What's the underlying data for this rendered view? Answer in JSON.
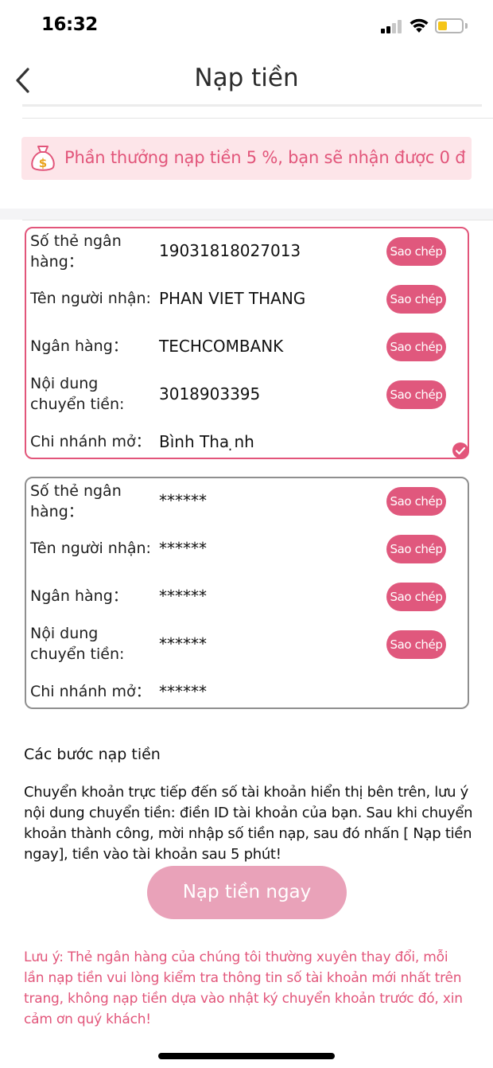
{
  "status_bar": {
    "time": "16:32"
  },
  "header": {
    "title": "Nạp tiền"
  },
  "bonus_banner": {
    "text": "Phần thưởng nạp tiền 5 %, bạn sẽ nhận được 0 đ",
    "icon": "money-bag-icon"
  },
  "accounts": [
    {
      "selected": true,
      "rows": [
        {
          "label": "Số thẻ ngân hàng：",
          "value": "19031818027013",
          "copy_label": "Sao chép"
        },
        {
          "label": "Tên người nhận:",
          "value": "PHAN VIET THANG",
          "copy_label": "Sao chép"
        },
        {
          "label": "Ngân hàng：",
          "value": "TECHCOMBANK",
          "copy_label": "Sao chép"
        },
        {
          "label": "Nội dung chuyển tiền:",
          "value": "3018903395",
          "copy_label": "Sao chép"
        },
        {
          "label": "Chi nhánh mở：",
          "value": "Bình Tha ̣nh"
        }
      ]
    },
    {
      "selected": false,
      "rows": [
        {
          "label": "Số thẻ ngân hàng：",
          "value": "******",
          "copy_label": "Sao chép"
        },
        {
          "label": "Tên người nhận:",
          "value": "******",
          "copy_label": "Sao chép"
        },
        {
          "label": "Ngân hàng：",
          "value": "******",
          "copy_label": "Sao chép"
        },
        {
          "label": "Nội dung chuyển tiền:",
          "value": "******",
          "copy_label": "Sao chép"
        },
        {
          "label": "Chi nhánh mở：",
          "value": "******"
        }
      ]
    }
  ],
  "steps": {
    "title": "Các bước nạp tiền",
    "body": "Chuyển khoản trực tiếp đến số tài khoản hiển thị bên trên, lưu ý nội dung chuyển tiền: điền ID tài khoản của bạn. Sau khi chuyển khoản thành công, mời nhập số tiền nạp, sau đó nhấn [ Nạp tiền ngay], tiền vào tài khoản sau 5 phút!"
  },
  "submit_button": {
    "label": "Nạp tiền ngay"
  },
  "note": "Lưu ý: Thẻ ngân hàng của chúng tôi thường xuyên thay đổi, mỗi lần nạp tiền vui lòng kiểm tra thông tin số tài khoản mới nhất trên trang, không nạp tiền dựa vào nhật ký chuyển khoản trước đó, xin cảm ơn quý khách!",
  "colors": {
    "accent": "#e2557a",
    "copy_button": "#e0587d",
    "submit_button": "#e9a2b9",
    "banner_bg": "#fde5e9",
    "inactive_border": "#8f8f8f"
  }
}
